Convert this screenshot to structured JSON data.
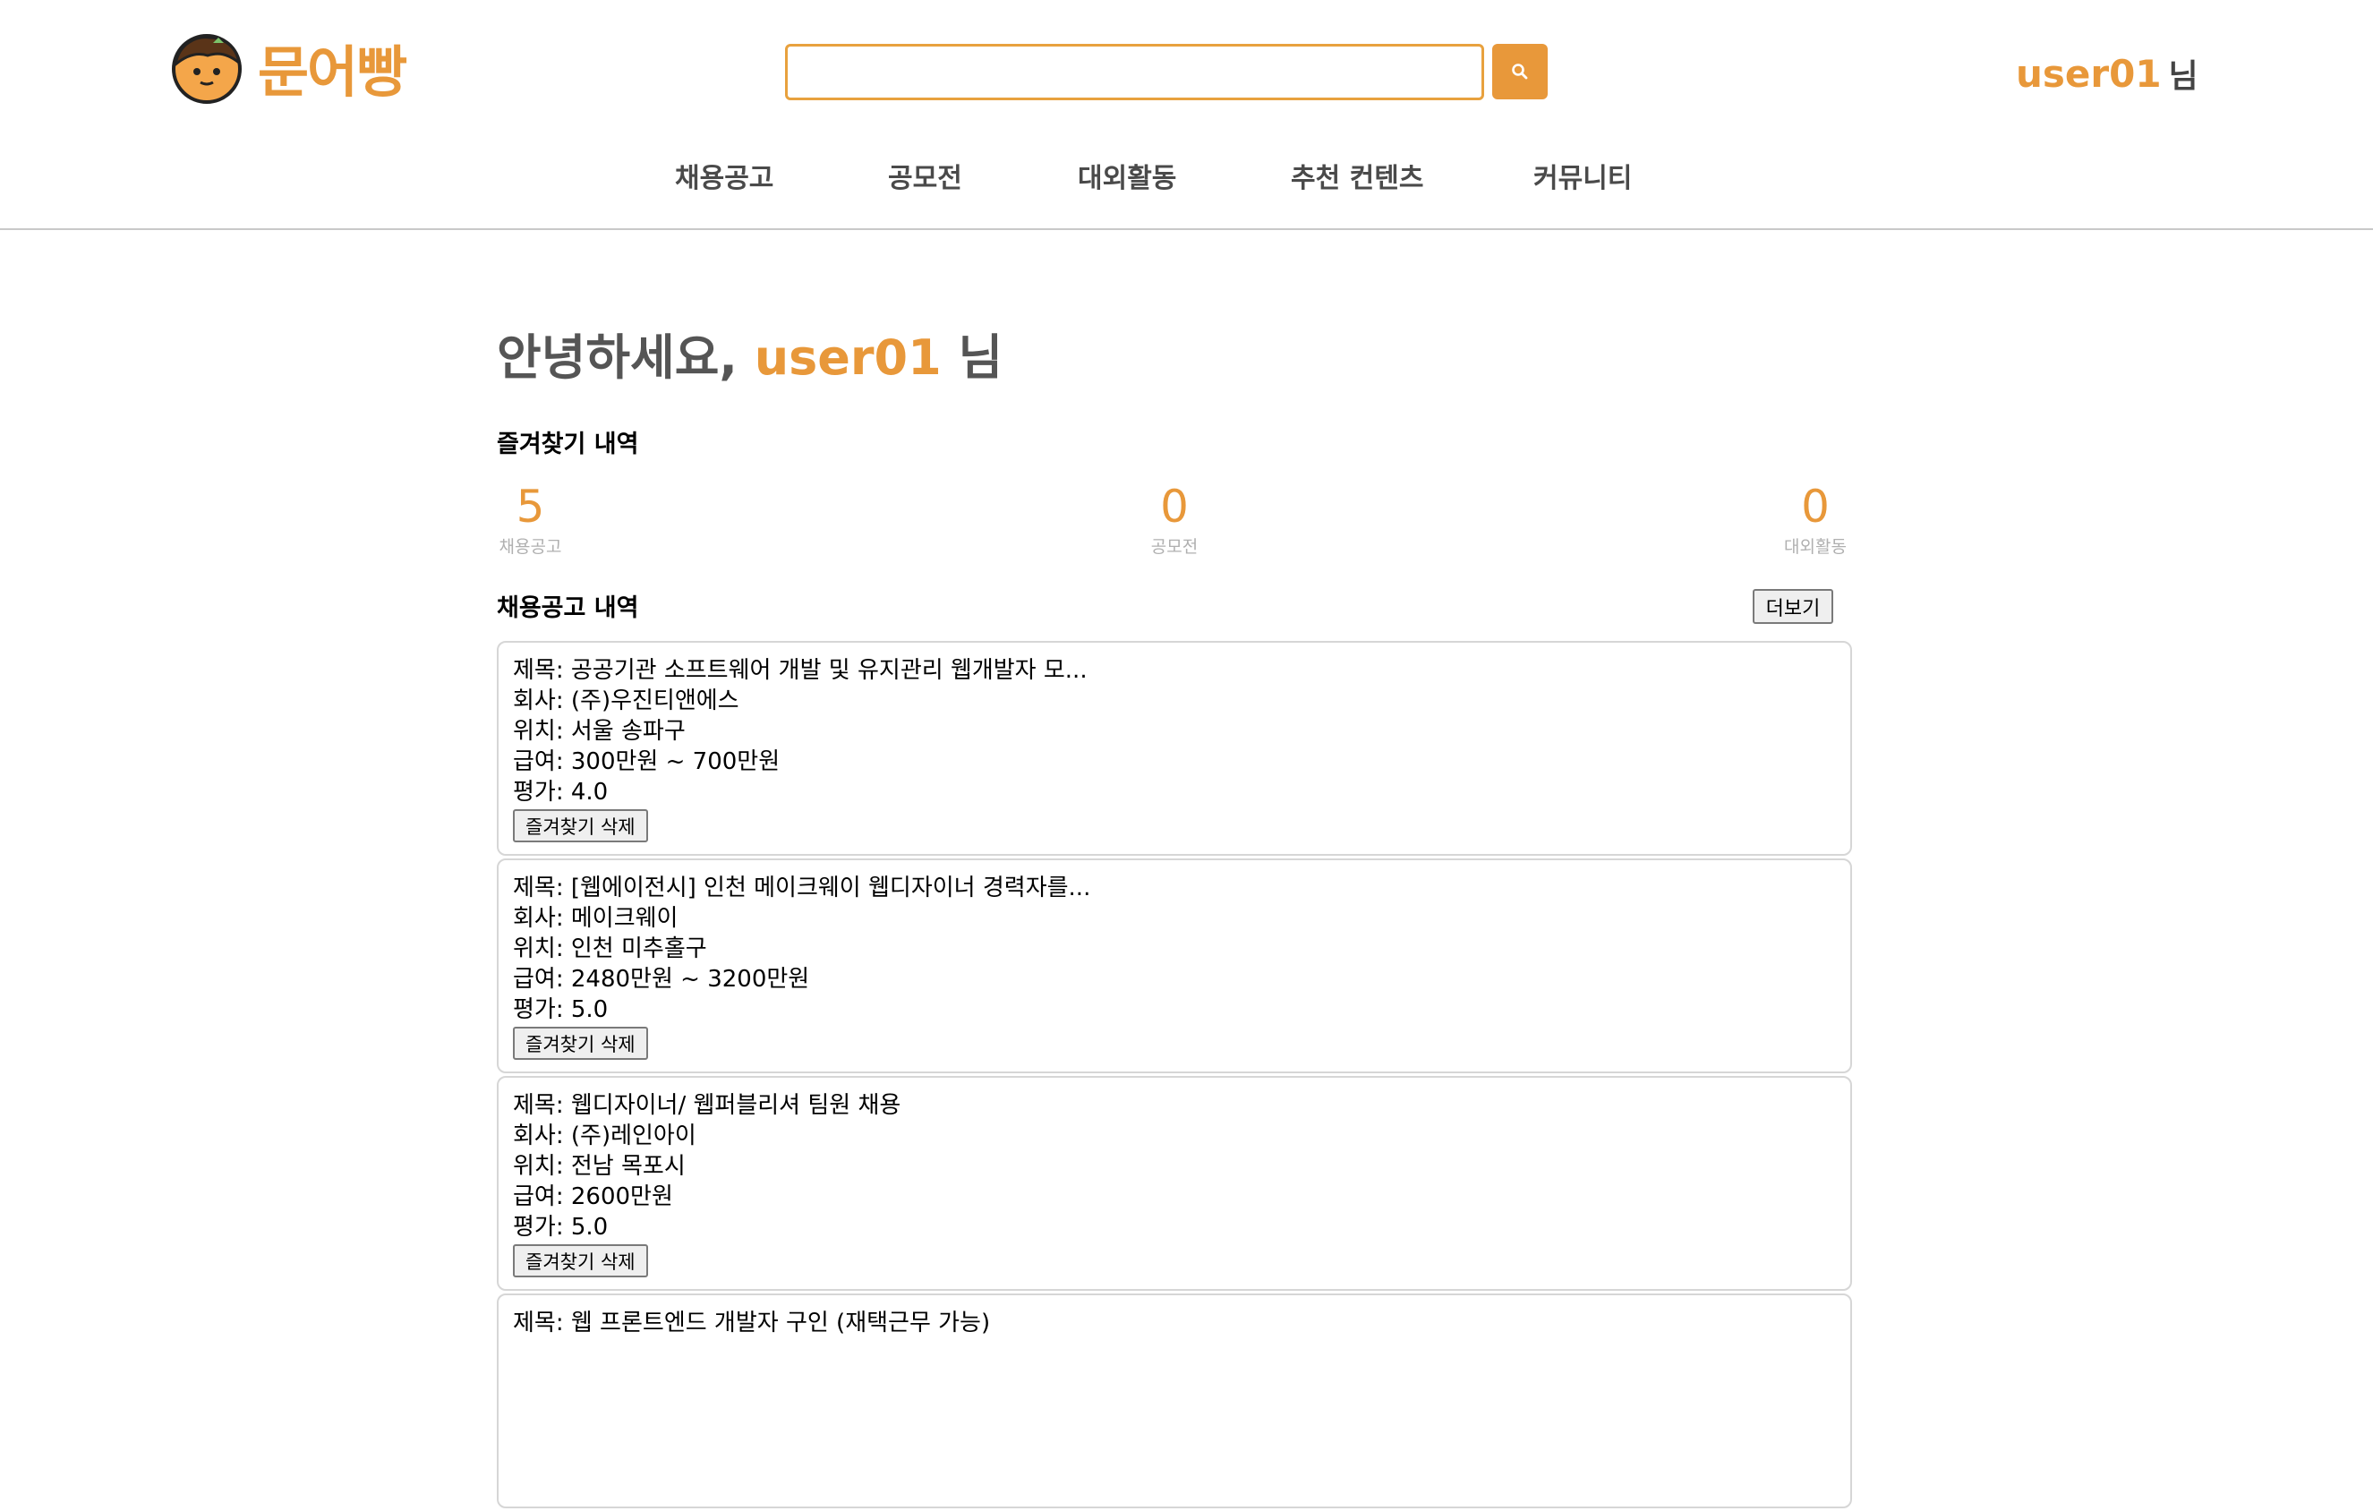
{
  "brand": {
    "name": "문어빵",
    "accent": "#e8983a"
  },
  "search": {
    "value": "",
    "placeholder": ""
  },
  "header_user": {
    "name": "user01",
    "suffix": "님"
  },
  "nav": [
    "채용공고",
    "공모전",
    "대외활동",
    "추천 컨텐츠",
    "커뮤니티"
  ],
  "greeting": {
    "prefix": "안녕하세요, ",
    "name": "user01",
    "suffix": " 님"
  },
  "favorites": {
    "title": "즐겨찾기 내역",
    "stats": [
      {
        "count": "5",
        "label": "채용공고"
      },
      {
        "count": "0",
        "label": "공모전"
      },
      {
        "count": "0",
        "label": "대외활동"
      }
    ]
  },
  "jobs": {
    "title": "채용공고 내역",
    "more_label": "더보기",
    "labels": {
      "title": "제목: ",
      "company": "회사: ",
      "location": "위치: ",
      "salary": "급여: ",
      "rating": "평가: "
    },
    "delete_label": "즐겨찾기 삭제",
    "items": [
      {
        "title": "공공기관 소프트웨어 개발 및 유지관리 웹개발자 모...",
        "company": "(주)우진티앤에스",
        "location": "서울 송파구",
        "salary": "300만원 ~ 700만원",
        "rating": "4.0"
      },
      {
        "title": "[웹에이전시] 인천 메이크웨이 웹디자이너 경력자를...",
        "company": "메이크웨이",
        "location": "인천 미추홀구",
        "salary": "2480만원 ~ 3200만원",
        "rating": "5.0"
      },
      {
        "title": "웹디자이너/ 웹퍼블리셔 팀원 채용",
        "company": "(주)레인아이",
        "location": "전남 목포시",
        "salary": "2600만원",
        "rating": "5.0"
      },
      {
        "title": "웹 프론트엔드 개발자 구인 (재택근무 가능)",
        "company": "",
        "location": "",
        "salary": "",
        "rating": ""
      }
    ]
  }
}
